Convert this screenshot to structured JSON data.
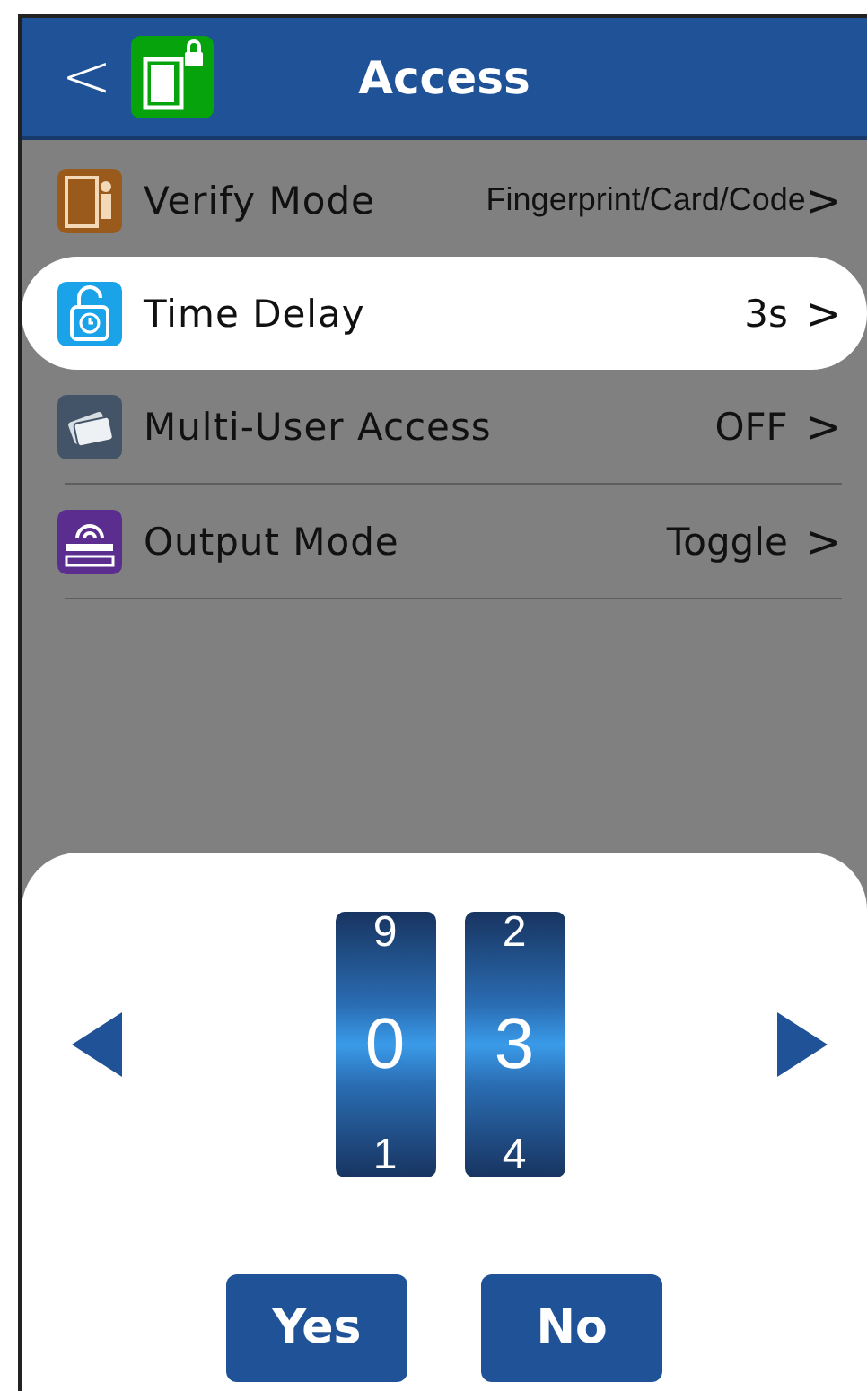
{
  "header": {
    "back": "<",
    "title": "Access"
  },
  "items": [
    {
      "label": "Verify Mode",
      "value": "Fingerprint/Card/Code",
      "chevron": ">",
      "selected": false
    },
    {
      "label": "Time Delay",
      "value": "3s",
      "chevron": ">",
      "selected": true
    },
    {
      "label": "Multi-User Access",
      "value": "OFF",
      "chevron": ">",
      "selected": false
    },
    {
      "label": "Output Mode",
      "value": "Toggle",
      "chevron": ">",
      "selected": false
    }
  ],
  "picker": {
    "wheels": [
      {
        "previous": "9",
        "current": "0",
        "next": "1"
      },
      {
        "previous": "2",
        "current": "3",
        "next": "4"
      }
    ],
    "buttons": [
      "Yes",
      "No"
    ]
  }
}
